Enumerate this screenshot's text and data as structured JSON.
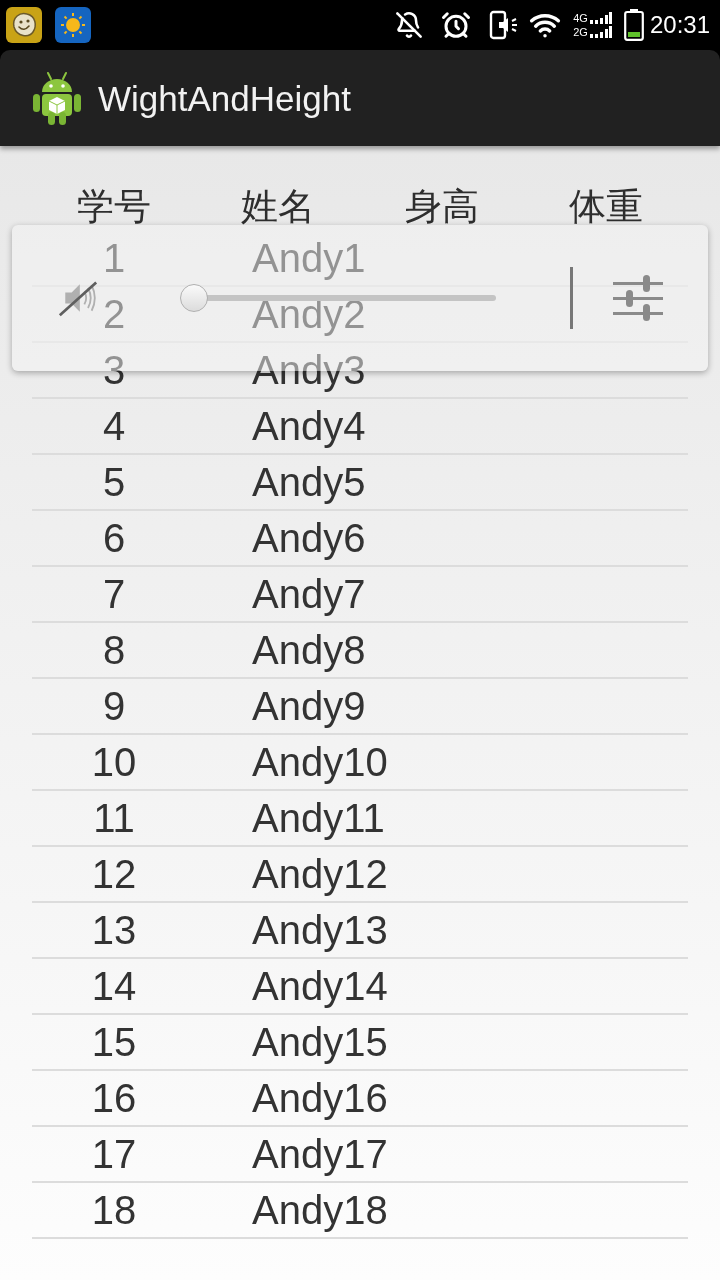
{
  "status_bar": {
    "network_labels": [
      "4G",
      "2G"
    ],
    "time": "20:31"
  },
  "app_bar": {
    "title": "WightAndHeight"
  },
  "table": {
    "columns": [
      "学号",
      "姓名",
      "身高",
      "体重"
    ],
    "rows": [
      [
        "1",
        "Andy1"
      ],
      [
        "2",
        "Andy2"
      ],
      [
        "3",
        "Andy3"
      ],
      [
        "4",
        "Andy4"
      ],
      [
        "5",
        "Andy5"
      ],
      [
        "6",
        "Andy6"
      ],
      [
        "7",
        "Andy7"
      ],
      [
        "8",
        "Andy8"
      ],
      [
        "9",
        "Andy9"
      ],
      [
        "10",
        "Andy10"
      ],
      [
        "11",
        "Andy11"
      ],
      [
        "12",
        "Andy12"
      ],
      [
        "13",
        "Andy13"
      ],
      [
        "14",
        "Andy14"
      ],
      [
        "15",
        "Andy15"
      ],
      [
        "16",
        "Andy16"
      ],
      [
        "17",
        "Andy17"
      ],
      [
        "18",
        "Andy18"
      ]
    ]
  },
  "volume_panel": {
    "muted": true,
    "level": 0
  }
}
